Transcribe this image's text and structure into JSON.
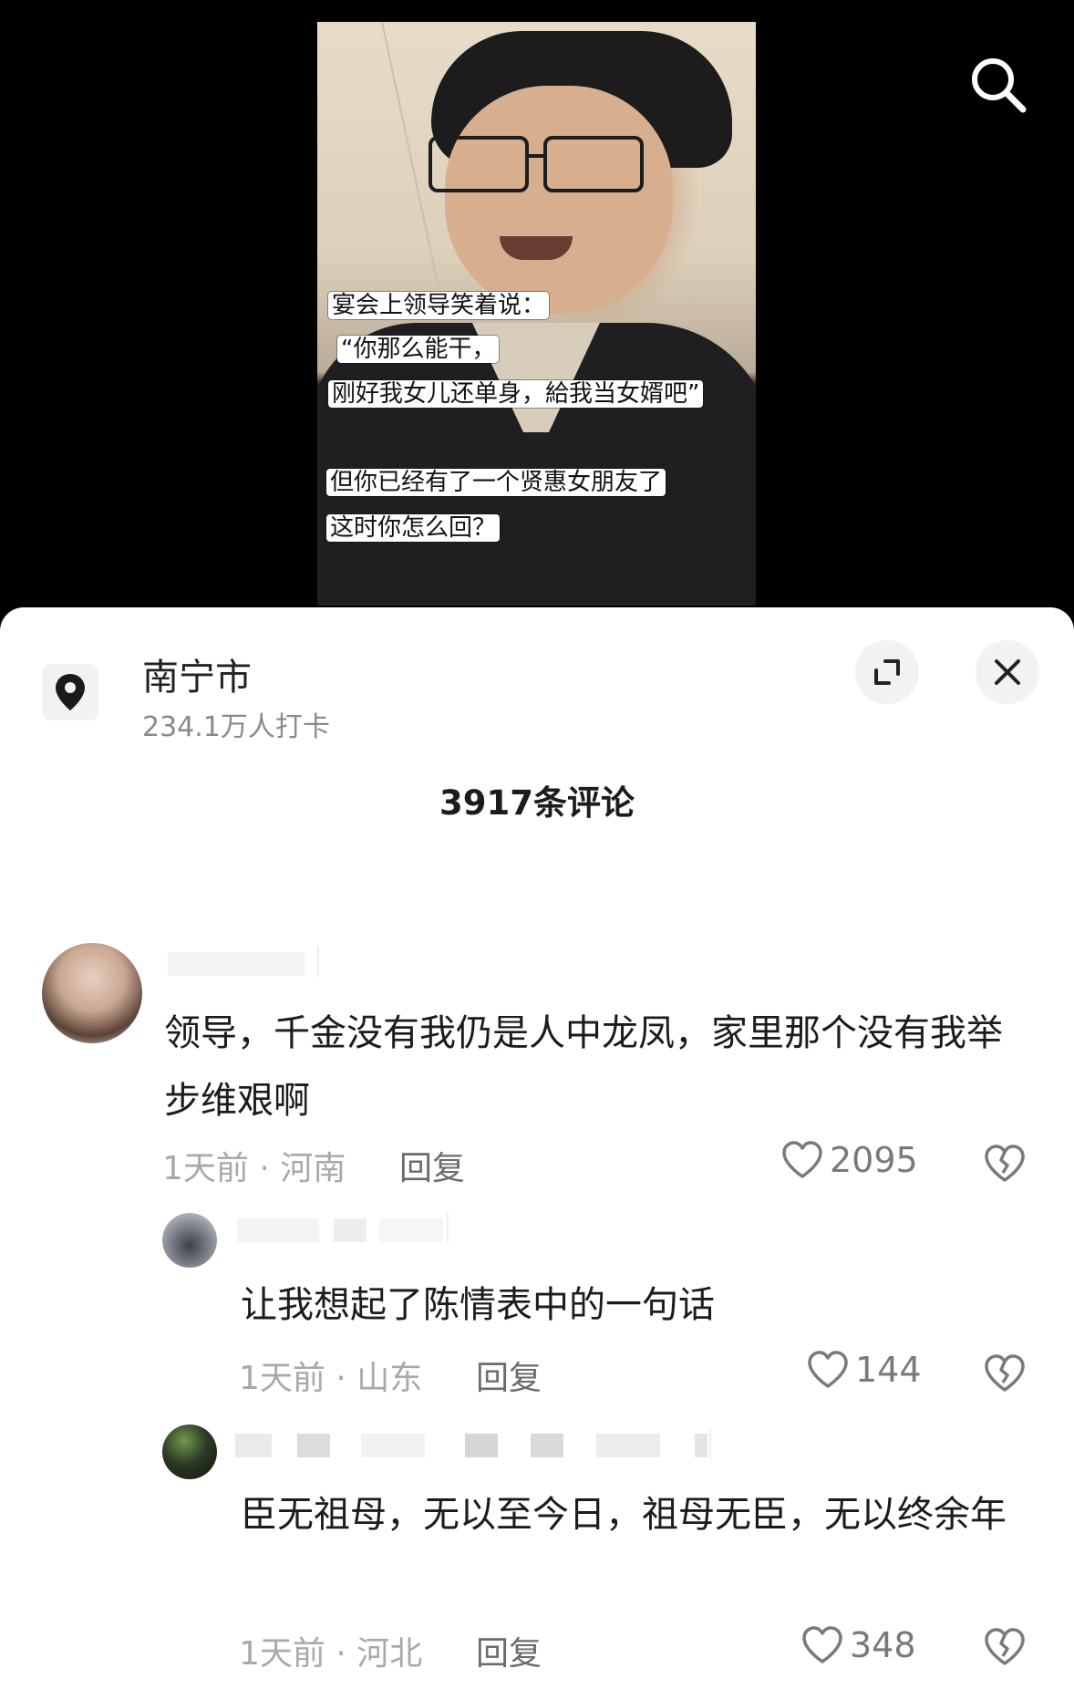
{
  "video": {
    "captions": [
      "宴会上领导笑着说：",
      "“你那么能干，",
      "刚好我女儿还单身，給我当女婿吧”",
      "但你已经有了一个贤惠女朋友了",
      "这时你怎么回？"
    ]
  },
  "location": {
    "name": "南宁市",
    "checkins": "234.1万人打卡"
  },
  "comments_header": {
    "count_label": "3917条评论"
  },
  "comments": [
    {
      "text": "领导，千金没有我仍是人中龙凤，家里那个没有我举步维艰啊",
      "time_region": "1天前 · 河南",
      "reply_label": "回复",
      "likes": "2095"
    },
    {
      "text": "让我想起了陈情表中的一句话",
      "time_region": "1天前 · 山东",
      "reply_label": "回复",
      "likes": "144"
    },
    {
      "text": "臣无祖母，无以至今日，祖母无臣，无以终余年",
      "time_region": "1天前 · 河北",
      "reply_label": "回复",
      "likes": "348"
    }
  ],
  "colors": {
    "sheet_bg": "#ffffff",
    "video_bg": "#000000",
    "meta_gray": "#a9a9ad",
    "text_dark": "#1c1c1c"
  },
  "icons": [
    "search-icon",
    "location-pin-icon",
    "expand-icon",
    "close-icon",
    "heart-icon",
    "broken-heart-icon"
  ]
}
